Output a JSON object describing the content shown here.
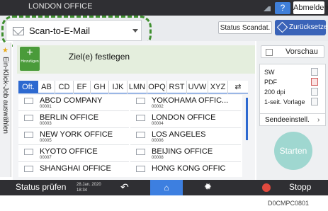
{
  "header": {
    "title": "LONDON OFFICE",
    "help_label": "?",
    "logout_label": "Abmelden"
  },
  "toolbar": {
    "app_selector": "Scan-to-E-Mail",
    "status_label": "Status Scandat.",
    "reset_label": "Zurücksetzen"
  },
  "side_tab": {
    "label": "Ein-Klick-Job auswählen"
  },
  "destination": {
    "add_label": "Hinzufügen",
    "field_label": "Ziel(e) festlegen"
  },
  "tabs": [
    "Oft.",
    "AB",
    "CD",
    "EF",
    "GH",
    "IJK",
    "LMN",
    "OPQ",
    "RST",
    "UVW",
    "XYZ"
  ],
  "entries": [
    {
      "name": "ABCD COMPANY",
      "num": "00001"
    },
    {
      "name": "YOKOHAMA OFFIC...",
      "num": "00002"
    },
    {
      "name": "BERLIN OFFICE",
      "num": "00003"
    },
    {
      "name": "LONDON OFFICE",
      "num": "00004"
    },
    {
      "name": "NEW YORK OFFICE",
      "num": "00005"
    },
    {
      "name": "LOS ANGELES",
      "num": "00006"
    },
    {
      "name": "KYOTO OFFICE",
      "num": "00007"
    },
    {
      "name": "BEIJING OFFICE",
      "num": "00008"
    },
    {
      "name": "SHANGHAI OFFICE",
      "num": ""
    },
    {
      "name": "HONG KONG OFFIC",
      "num": ""
    }
  ],
  "right_panel": {
    "preview_label": "Vorschau",
    "settings": [
      "SW",
      "PDF",
      "200 dpi",
      "1-seit. Vorlage"
    ],
    "send_settings_label": "Sendeeinstell.",
    "start_label": "Starten"
  },
  "bottombar": {
    "status_label": "Status prüfen",
    "date": "28.Jan. 2020",
    "time": "18:34",
    "stop_label": "Stopp"
  },
  "caption": "D0CMPC0801"
}
